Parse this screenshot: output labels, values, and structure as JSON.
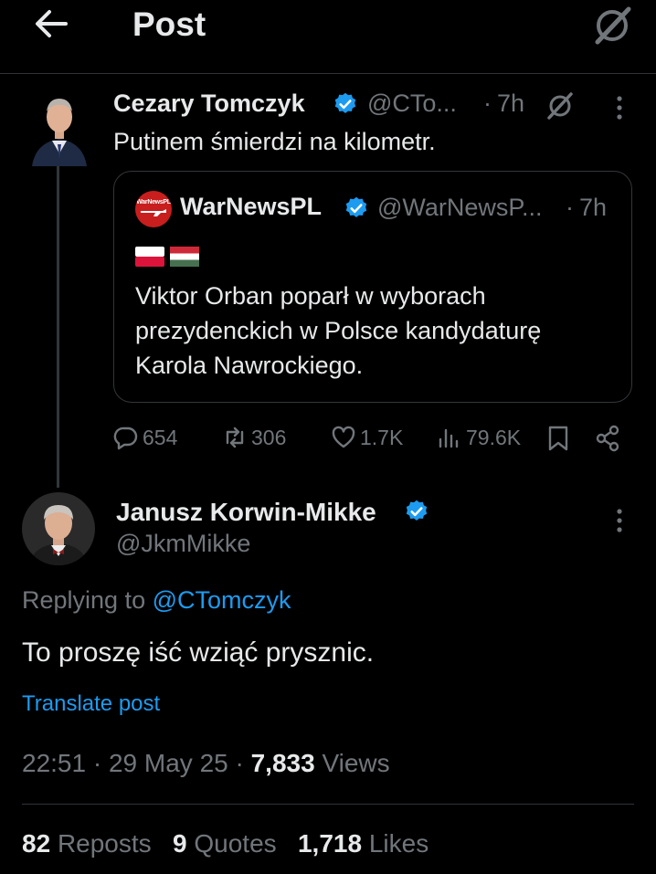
{
  "header": {
    "title": "Post",
    "back_icon": "arrow-left-icon",
    "grok_icon": "grok-icon"
  },
  "parent_post": {
    "author_name": "Cezary Tomczyk",
    "handle": "@CTo...",
    "dot": "·",
    "time": "7h",
    "text": "Putinem śmierdzi na kilometr.",
    "quoted": {
      "author_name": "WarNewsPL",
      "avatar_text": "WarNewsPL",
      "handle": "@WarNewsP...",
      "dot": "·",
      "time": "7h",
      "flags": "🇵🇱🇭🇺",
      "text_line1": "Viktor Orban poparł w wyborach",
      "text_line2": "prezydenckich w Polsce kandydaturę",
      "text_line3": "Karola Nawrockiego."
    },
    "actions": {
      "replies": "654",
      "reposts": "306",
      "likes": "1.7K",
      "views": "79.6K"
    }
  },
  "reply_post": {
    "author_name": "Janusz Korwin-Mikke",
    "handle": "@JkmMikke",
    "replying_prefix": "Replying to",
    "replying_to": "@CTomczyk",
    "text": "To proszę iść wziąć prysznic.",
    "translate": "Translate post",
    "time": "22:51",
    "date": "29 May 25",
    "views_count": "7,833",
    "views_label": "Views",
    "dot": "·"
  },
  "stats": {
    "reposts_count": "82",
    "reposts_label": "Reposts",
    "quotes_count": "9",
    "quotes_label": "Quotes",
    "likes_count": "1,718",
    "likes_label": "Likes"
  },
  "colors": {
    "background": "#000000",
    "text": "#e7e9ea",
    "muted": "#71767b",
    "accent": "#1d9bf0",
    "border": "#2f3336"
  }
}
